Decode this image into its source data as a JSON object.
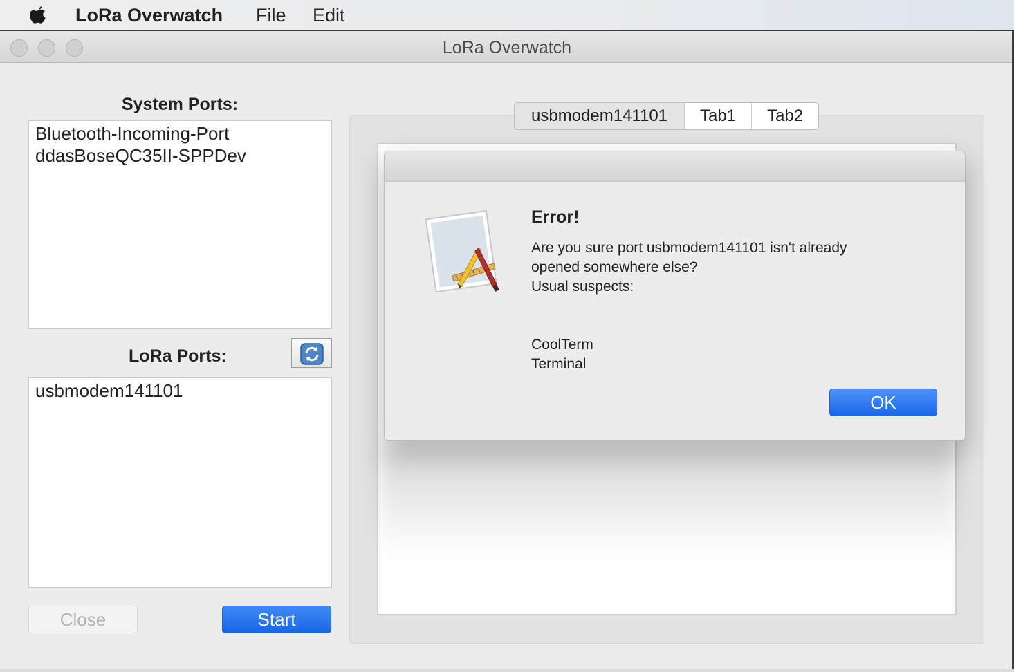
{
  "menubar": {
    "app_name": "LoRa Overwatch",
    "file": "File",
    "edit": "Edit"
  },
  "window": {
    "title": "LoRa Overwatch"
  },
  "system_ports": {
    "label": "System Ports:",
    "items": [
      "Bluetooth-Incoming-Port",
      "ddasBoseQC35II-SPPDev"
    ]
  },
  "lora_ports": {
    "label": "LoRa Ports:",
    "items": [
      "usbmodem141101"
    ]
  },
  "buttons": {
    "close": "Close",
    "start": "Start"
  },
  "tabs": [
    "usbmodem141101",
    "Tab1",
    "Tab2"
  ],
  "dialog": {
    "title": "Error!",
    "message_line1": "Are you sure port usbmodem141101 isn't already",
    "message_line2": "opened somewhere else?",
    "message_line3": "Usual suspects:",
    "suspects": [
      "CoolTerm",
      "Terminal"
    ],
    "ok": "OK",
    "icon": "app-dev-icon"
  },
  "colors": {
    "accent_blue": "#1a64e6"
  }
}
